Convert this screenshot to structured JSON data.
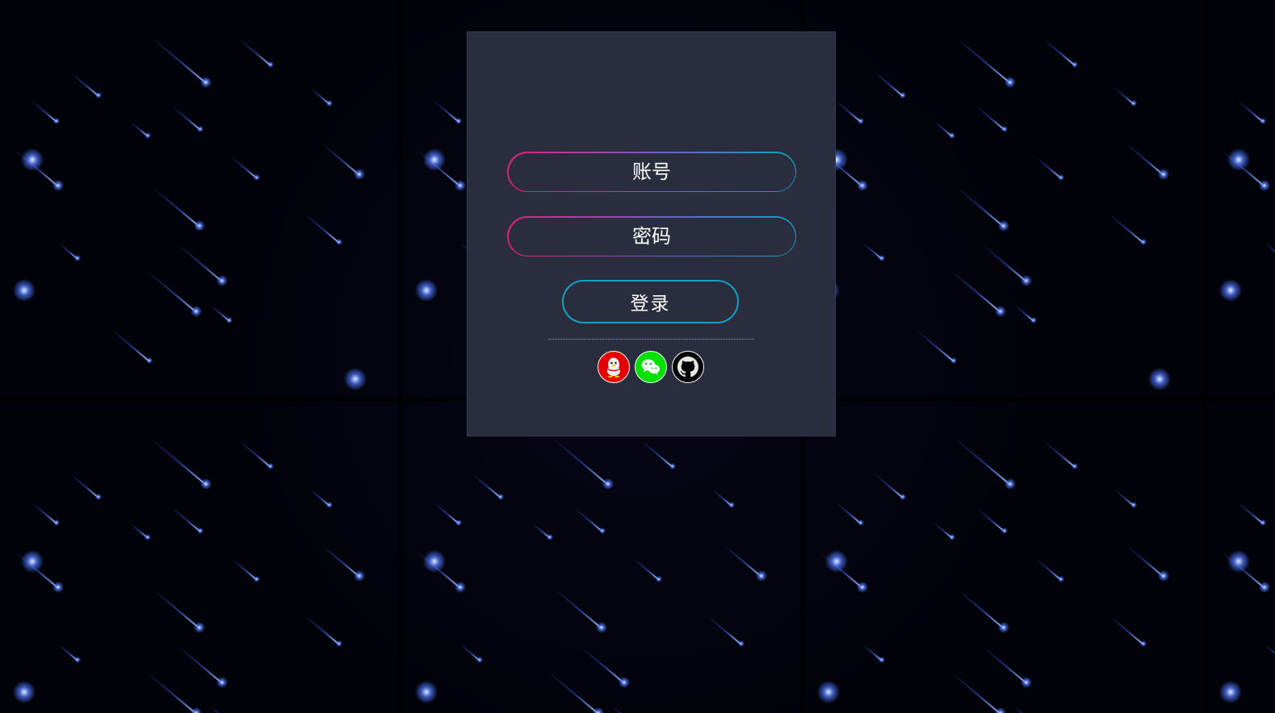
{
  "login": {
    "account_placeholder": "账号",
    "password_placeholder": "密码",
    "login_button_label": "登录"
  },
  "social_logins": [
    {
      "name": "qq",
      "icon": "qq-penguin-icon",
      "color": "#e40000"
    },
    {
      "name": "wechat",
      "icon": "wechat-icon",
      "color": "#00e000"
    },
    {
      "name": "github",
      "icon": "github-icon",
      "color": "#000000"
    }
  ],
  "colors": {
    "panel": "#2a2d3e",
    "field_gradient_start": "#e0217a",
    "field_gradient_end": "#0fa3c3",
    "button_border": "#14a1c3",
    "background": "#02020a",
    "meteor": "#3c64ff"
  }
}
